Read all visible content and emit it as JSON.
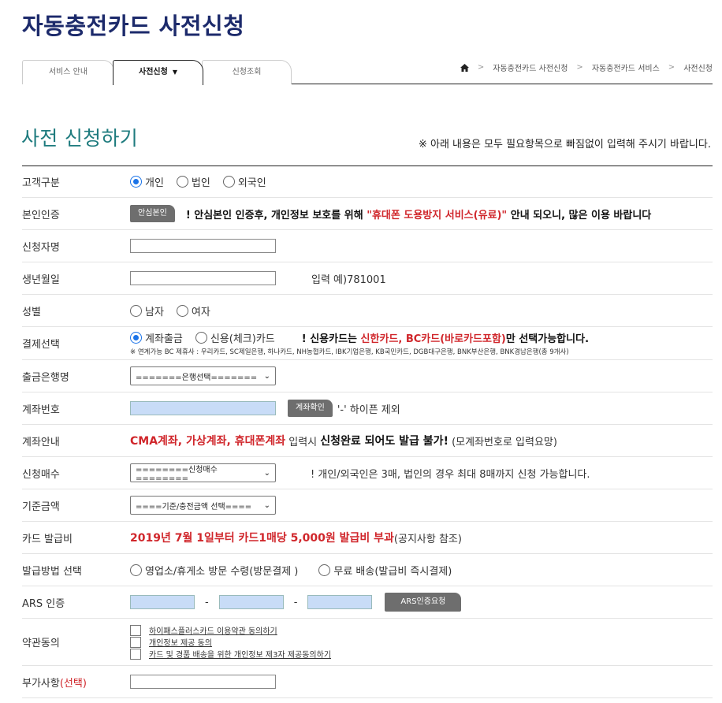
{
  "page_title": "자동충전카드 사전신청",
  "tabs": [
    {
      "label": "서비스 안내"
    },
    {
      "label": "사전신청",
      "caret": "▼"
    },
    {
      "label": "신청조회"
    }
  ],
  "breadcrumb": [
    "자동충전카드 사전신청",
    "자동충전카드 서비스",
    "사전신청"
  ],
  "breadcrumb_sep": ">",
  "section_title": "사전 신청하기",
  "notice": "※ 아래 내용은 모두 필요항목으로 빠짐없이 입력해 주시기 바랍니다.",
  "form": {
    "customer_type": {
      "label": "고객구분",
      "options": [
        "개인",
        "법인",
        "외국인"
      ],
      "selected": "개인"
    },
    "auth": {
      "label": "본인인증",
      "button": "안심본인",
      "text_pre": "! 안심본인 인증후, 개인정보 보호를 위해 ",
      "text_red": "\"휴대폰 도용방지 서비스(유료)\"",
      "text_post": " 안내 되오니, 많은 이용 바랍니다"
    },
    "applicant_name": {
      "label": "신청자명"
    },
    "birth_date": {
      "label": "생년월일",
      "hint": "입력 예)781001"
    },
    "gender": {
      "label": "성별",
      "options": [
        "남자",
        "여자"
      ]
    },
    "payment": {
      "label": "결제선택",
      "options": [
        "계좌출금",
        "신용(체크)카드"
      ],
      "selected": "계좌출금",
      "note_pre": "! 신용카드는 ",
      "note_red": "신한카드, BC카드(바로카드포함)",
      "note_post": "만 선택가능합니다.",
      "sub_note": "※ 연계가능 BC 제휴사 : 우리카드, SC제일은행, 하나카드, NH농협카드, IBK기업은행, KB국민카드, DGB대구은행, BNK부산은행, BNK경남은행(총 9개사)"
    },
    "bank": {
      "label": "출금은행명",
      "select": "=======은행선택======="
    },
    "account": {
      "label": "계좌번호",
      "button": "계좌확인",
      "hint": "'-' 하이픈 제외"
    },
    "account_info": {
      "label": "계좌안내",
      "red": "CMA계좌, 가상계좌, 휴대폰계좌",
      "mid": " 입력시 ",
      "bold": "신청완료 되어도 발급 불가!",
      "tail": " (모계좌번호로 입력요망)"
    },
    "card_count": {
      "label": "신청매수",
      "select": "========신청매수========",
      "hint": "! 개인/외국인은 3매, 법인의 경우 최대 8매까지 신청 가능합니다."
    },
    "base_amount": {
      "label": "기준금액",
      "select": "====기준/충전금액 선택===="
    },
    "card_fee": {
      "label": "카드 발급비",
      "red": "2019년 7월 1일부터 카드1매당 5,000원 발급비 부과",
      "tail": "(공지사항 참조)"
    },
    "issue_method": {
      "label": "발급방법 선택",
      "options": [
        "영업소/휴게소 방문 수령(방문결제 )",
        "무료 배송(발급비 즉시결제)"
      ]
    },
    "ars": {
      "label": "ARS 인증",
      "dash": "-",
      "button": "ARS인증요청"
    },
    "terms": {
      "label": "약관동의",
      "items": [
        "하이패스플러스카드 이용약관 동의하기",
        "개인정보 제공 동의",
        "카드 및 경품 배송을 위한 개인정보 제3자 제공동의하기"
      ]
    },
    "extra": {
      "label": "부가사항",
      "label_red": "(선택)"
    }
  },
  "colors": {
    "title": "#1c2a6b",
    "section": "#1e7b7e",
    "accent_red": "#d0262b",
    "radio_on": "#1a73e8"
  }
}
